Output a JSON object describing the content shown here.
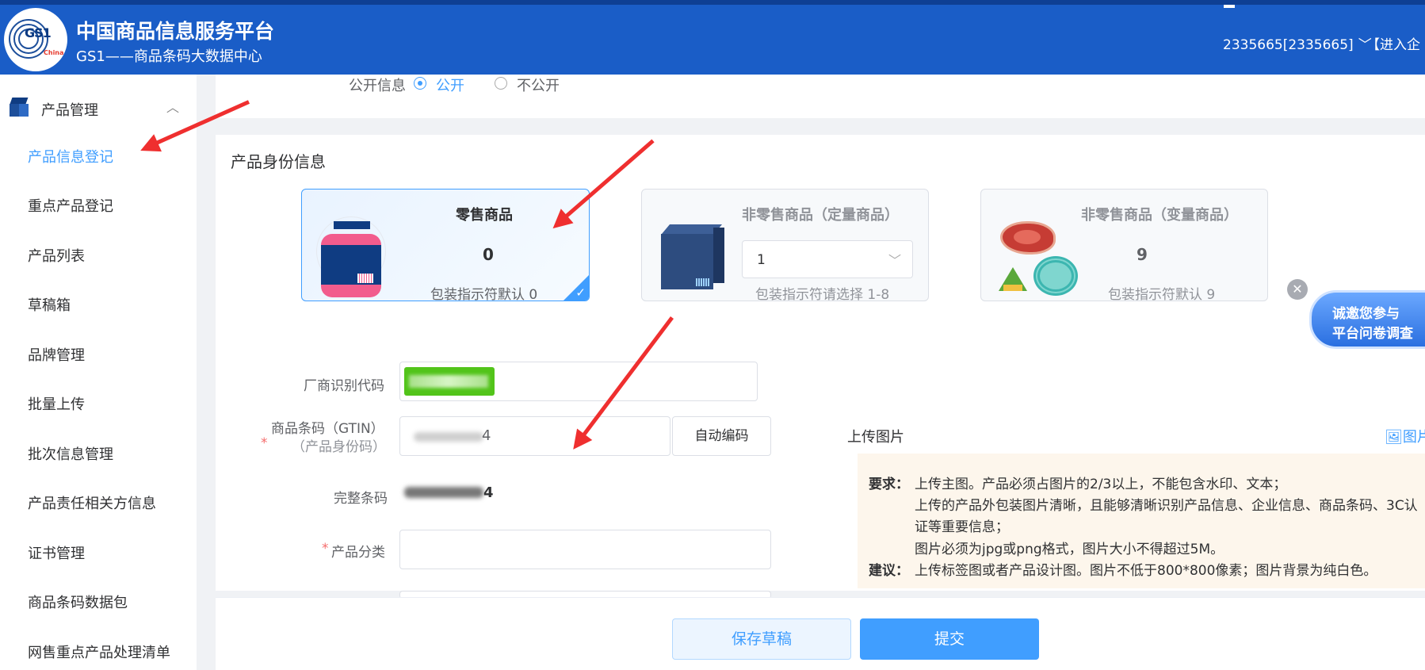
{
  "header": {
    "logo_text": "GS1",
    "logo_sub": "China",
    "title": "中国商品信息服务平台",
    "subtitle": "GS1——商品条码大数据中心",
    "user": "2335665[2335665]",
    "enter": "【进入企"
  },
  "sidebar": {
    "group_label": "产品管理",
    "items": [
      {
        "label": "产品信息登记",
        "active": true
      },
      {
        "label": "重点产品登记"
      },
      {
        "label": "产品列表"
      },
      {
        "label": "草稿箱"
      },
      {
        "label": "品牌管理"
      },
      {
        "label": "批量上传"
      },
      {
        "label": "批次信息管理"
      },
      {
        "label": "产品责任相关方信息"
      },
      {
        "label": "证书管理"
      },
      {
        "label": "商品条码数据包"
      },
      {
        "label": "网售重点产品处理清单"
      }
    ]
  },
  "public_info": {
    "label": "公开信息",
    "option_public": "公开",
    "option_private": "不公开",
    "selected": "公开"
  },
  "identity": {
    "section_title": "产品身份信息",
    "cards": [
      {
        "title": "零售商品",
        "number": "0",
        "note": "包装指示符默认 0",
        "selected": true,
        "icon": "jar-icon"
      },
      {
        "title": "非零售商品（定量商品）",
        "select_value": "1",
        "note": "包装指示符请选择 1-8",
        "icon": "box-icon"
      },
      {
        "title": "非零售商品（变量商品）",
        "number": "9",
        "note": "包装指示符默认 9",
        "icon": "meat-icon"
      }
    ]
  },
  "form": {
    "vendor_code_label": "厂商识别代码",
    "gtin_label_1": "商品条码（GTIN）",
    "gtin_label_2": "（产品身份码）",
    "gtin_tail": "4",
    "auto_code_button": "自动编码",
    "full_code_label": "完整条码",
    "full_code_tail": "4",
    "category_label": "产品分类",
    "required_mark": "*"
  },
  "upload": {
    "title": "上传图片",
    "link": "图片",
    "requirements_key": "要求：",
    "requirements": [
      "上传主图。产品必须占图片的2/3以上，不能包含水印、文本；",
      "上传的产品外包装图片清晰，且能够清晰识别产品信息、企业信息、商品条码、3C认",
      "证等重要信息；",
      "图片必须为jpg或png格式，图片大小不得超过5M。"
    ],
    "suggestion_key": "建议：",
    "suggestion": "上传标签图或者产品设计图。图片不低于800*800像素；图片背景为纯白色。"
  },
  "survey": {
    "line1": "诚邀您参与",
    "line2": "平台问卷调查"
  },
  "footer": {
    "save_draft": "保存草稿",
    "submit": "提交"
  },
  "colors": {
    "header": "#1a5dc7",
    "accent": "#409eff",
    "arrow": "#ef2f2f",
    "notice_bg": "#fdf6ec"
  }
}
